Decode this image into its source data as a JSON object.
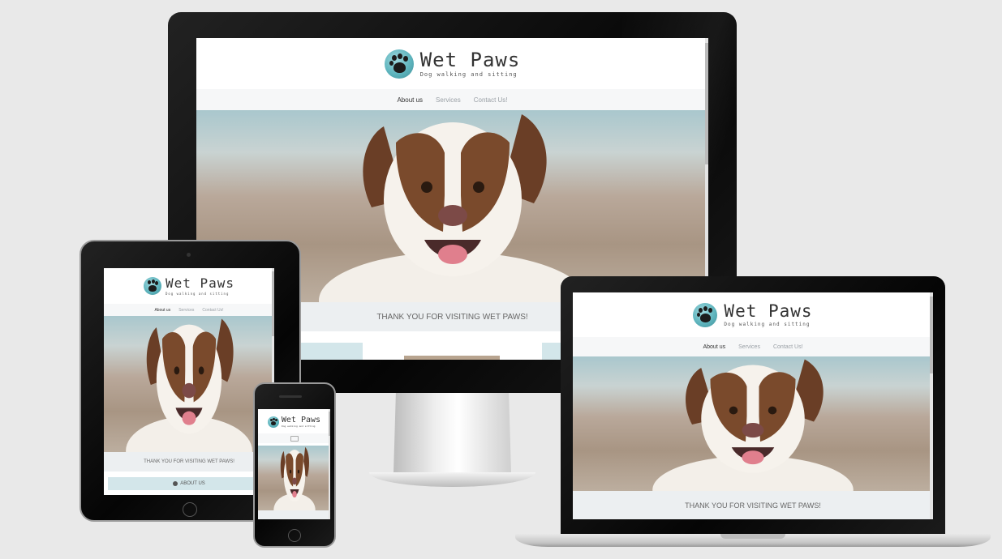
{
  "site": {
    "brand_name": "Wet Paws",
    "brand_tagline": "Dog walking and sitting",
    "nav": [
      "About us",
      "Services",
      "Contact Us!"
    ],
    "thanks": "THANK YOU FOR VISITING WET PAWS!",
    "about_button": "ABOUT US",
    "menu_icon": "hamburger-icon",
    "about_icon": "info-circle-icon"
  },
  "colors": {
    "page_bg": "#e9e9e9",
    "brand_teal": "#5fb5be",
    "nav_bg": "#f6f7f8",
    "thanks_bg": "#eceff1",
    "card_bg": "#d3e6ea"
  }
}
